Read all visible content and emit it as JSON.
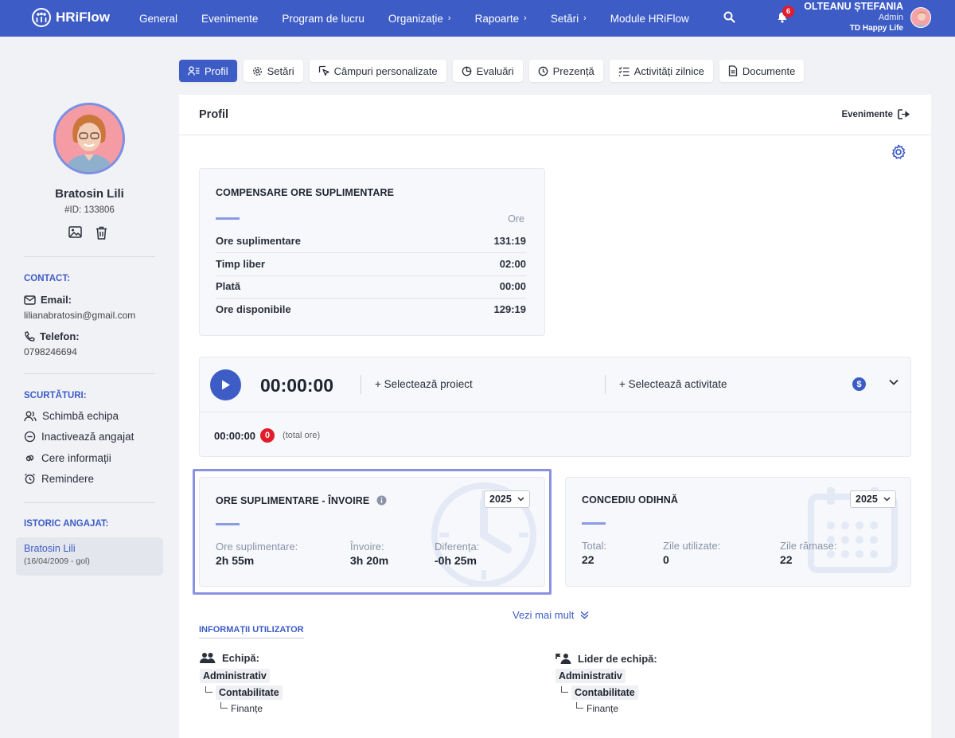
{
  "app": {
    "name": "HRiFlow"
  },
  "nav": [
    {
      "label": "General",
      "has_sub": false
    },
    {
      "label": "Evenimente",
      "has_sub": false
    },
    {
      "label": "Program de lucru",
      "has_sub": false
    },
    {
      "label": "Organizație",
      "has_sub": true
    },
    {
      "label": "Rapoarte",
      "has_sub": true
    },
    {
      "label": "Setări",
      "has_sub": true
    },
    {
      "label": "Module HRiFlow",
      "has_sub": false
    }
  ],
  "notifications": {
    "count": "6"
  },
  "user": {
    "name": "OLTEANU ȘTEFANIA",
    "role": "Admin",
    "company": "TD Happy Life"
  },
  "employee": {
    "name": "Bratosin Lili",
    "id": "#ID: 133806"
  },
  "contact": {
    "title": "CONTACT:",
    "email_label": "Email:",
    "email": "lilianabratosin@gmail.com",
    "phone_label": "Telefon:",
    "phone": "0798246694"
  },
  "shortcuts": {
    "title": "SCURTĂTURI:",
    "items": [
      "Schimbă echipa",
      "Inactivează angajat",
      "Cere informații",
      "Remindere"
    ]
  },
  "history": {
    "title": "ISTORIC ANGAJAT:",
    "name": "Bratosin Lili",
    "date": "(16/04/2009 - gol)"
  },
  "tabs": [
    {
      "label": "Profil",
      "icon": "user-list-icon",
      "active": true
    },
    {
      "label": "Setări",
      "icon": "gear-icon",
      "active": false
    },
    {
      "label": "Câmpuri personalizate",
      "icon": "edit-cursor-icon",
      "active": false
    },
    {
      "label": "Evaluări",
      "icon": "pie-chart-icon",
      "active": false
    },
    {
      "label": "Prezență",
      "icon": "clock-icon",
      "active": false
    },
    {
      "label": "Activități zilnice",
      "icon": "checklist-icon",
      "active": false
    },
    {
      "label": "Documente",
      "icon": "document-icon",
      "active": false
    }
  ],
  "main": {
    "title": "Profil",
    "events_link": "Evenimente"
  },
  "compensation": {
    "title": "COMPENSARE ORE SUPLIMENTARE",
    "unit": "Ore",
    "rows": [
      {
        "label": "Ore suplimentare",
        "value": "131:19"
      },
      {
        "label": "Timp liber",
        "value": "02:00"
      },
      {
        "label": "Plată",
        "value": "00:00"
      },
      {
        "label": "Ore disponibile",
        "value": "129:19"
      }
    ]
  },
  "timer": {
    "value": "00:00:00",
    "project": "+ Selectează proiect",
    "activity": "+ Selectează activitate",
    "total": "00:00:00",
    "badge": "0",
    "note": "(total ore)"
  },
  "overtime": {
    "title": "ORE SUPLIMENTARE - ÎNVOIRE",
    "year": "2025",
    "stats": [
      {
        "label": "Ore suplimentare:",
        "value": "2h 55m"
      },
      {
        "label": "Învoire:",
        "value": "3h 20m"
      },
      {
        "label": "Diferența:",
        "value": "-0h 25m"
      }
    ]
  },
  "leave": {
    "title": "CONCEDIU ODIHNĂ",
    "year": "2025",
    "stats": [
      {
        "label": "Total:",
        "value": "22"
      },
      {
        "label": "Zile utilizate:",
        "value": "0"
      },
      {
        "label": "Zile rămase:",
        "value": "22"
      }
    ]
  },
  "see_more": "Vezi mai mult",
  "user_info": {
    "title": "INFORMAȚII UTILIZATOR",
    "team_label": "Echipă:",
    "leader_label": "Lider de echipă:",
    "tree": [
      "Administrativ",
      "Contabilitate",
      "Finanțe"
    ]
  },
  "colors": {
    "primary": "#3d5cc6",
    "badge": "#e11d2b",
    "accent": "#8b9be4",
    "highlight": "#8b90e0"
  }
}
